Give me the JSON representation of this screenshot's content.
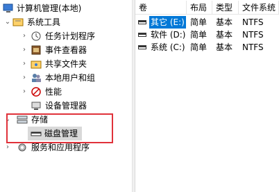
{
  "tree": {
    "root": {
      "label": "计算机管理(本地)"
    },
    "items": [
      {
        "label": "系统工具",
        "icon": "system-tools-icon",
        "expanded": true
      },
      {
        "label": "任务计划程序",
        "icon": "task-scheduler-icon"
      },
      {
        "label": "事件查看器",
        "icon": "event-viewer-icon"
      },
      {
        "label": "共享文件夹",
        "icon": "shared-folders-icon"
      },
      {
        "label": "本地用户和组",
        "icon": "local-users-icon"
      },
      {
        "label": "性能",
        "icon": "performance-icon"
      },
      {
        "label": "设备管理器",
        "icon": "device-manager-icon"
      },
      {
        "label": "存储",
        "icon": "storage-icon",
        "expanded": true
      },
      {
        "label": "磁盘管理",
        "icon": "disk-management-icon"
      },
      {
        "label": "服务和应用程序",
        "icon": "services-apps-icon"
      }
    ]
  },
  "table": {
    "columns": [
      "卷",
      "布局",
      "类型",
      "文件系统"
    ],
    "rows": [
      {
        "volume": "其它 (E:)",
        "layout": "简单",
        "type": "基本",
        "fs": "NTFS"
      },
      {
        "volume": "软件 (D:)",
        "layout": "简单",
        "type": "基本",
        "fs": "NTFS"
      },
      {
        "volume": "系统 (C:)",
        "layout": "简单",
        "type": "基本",
        "fs": "NTFS"
      }
    ]
  },
  "colors": {
    "highlight": "#e0323a",
    "selection": "#0078d7"
  }
}
